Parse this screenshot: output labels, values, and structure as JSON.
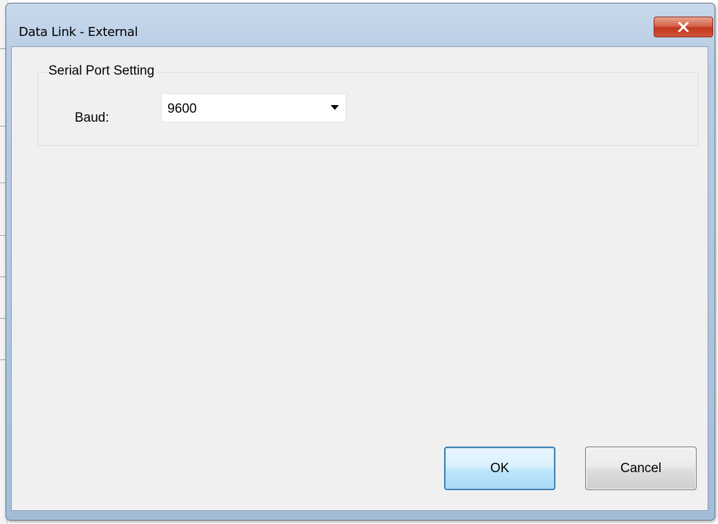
{
  "window": {
    "title": "Data Link - External",
    "close_icon": "close-icon"
  },
  "group": {
    "legend": "Serial Port Setting"
  },
  "baud": {
    "label": "Baud:",
    "value": "9600",
    "arrow_icon": "chevron-down-icon"
  },
  "buttons": {
    "ok_label": "OK",
    "cancel_label": "Cancel"
  },
  "colors": {
    "frame": "#b9cde4",
    "client": "#f0f0f0",
    "close_button": "#c1371d",
    "ok_border": "#3c7fb1"
  }
}
